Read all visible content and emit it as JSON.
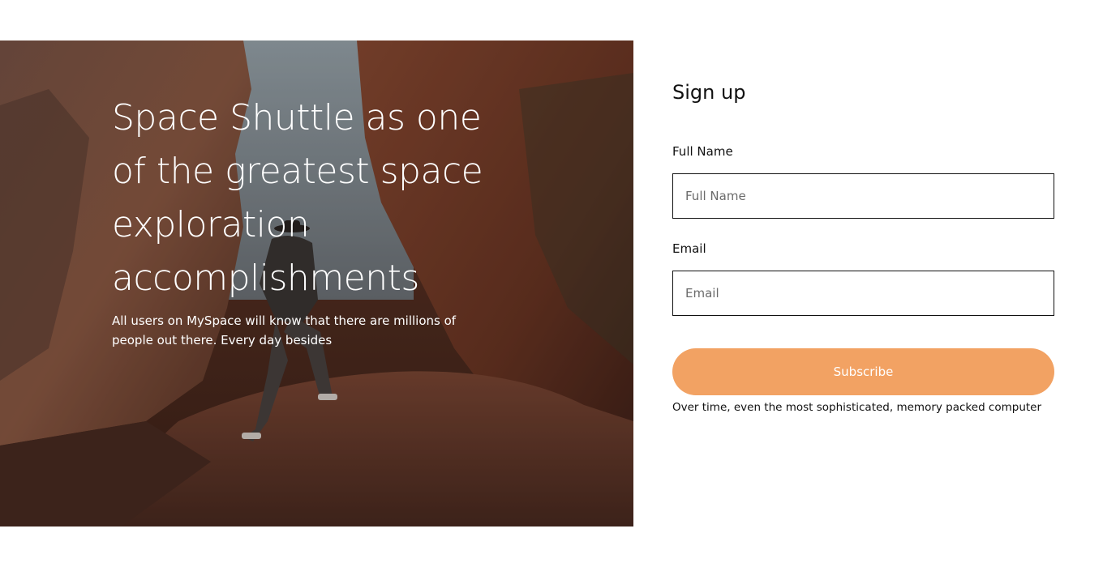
{
  "hero": {
    "title": "Space Shuttle as one of the greatest space exploration accomplishments",
    "text": "All users on MySpace will know that there are millions of people out there. Every day besides"
  },
  "form": {
    "title": "Sign up",
    "full_name": {
      "label": "Full Name",
      "placeholder": "Full Name",
      "value": ""
    },
    "email": {
      "label": "Email",
      "placeholder": "Email",
      "value": ""
    },
    "submit_label": "Subscribe",
    "note": "Over time, even the most sophisticated, memory packed computer"
  },
  "colors": {
    "accent": "#f2a263",
    "text": "#111111",
    "border": "#111111"
  },
  "icons": {
    "hero_image": "canyon-hiker-photo"
  }
}
